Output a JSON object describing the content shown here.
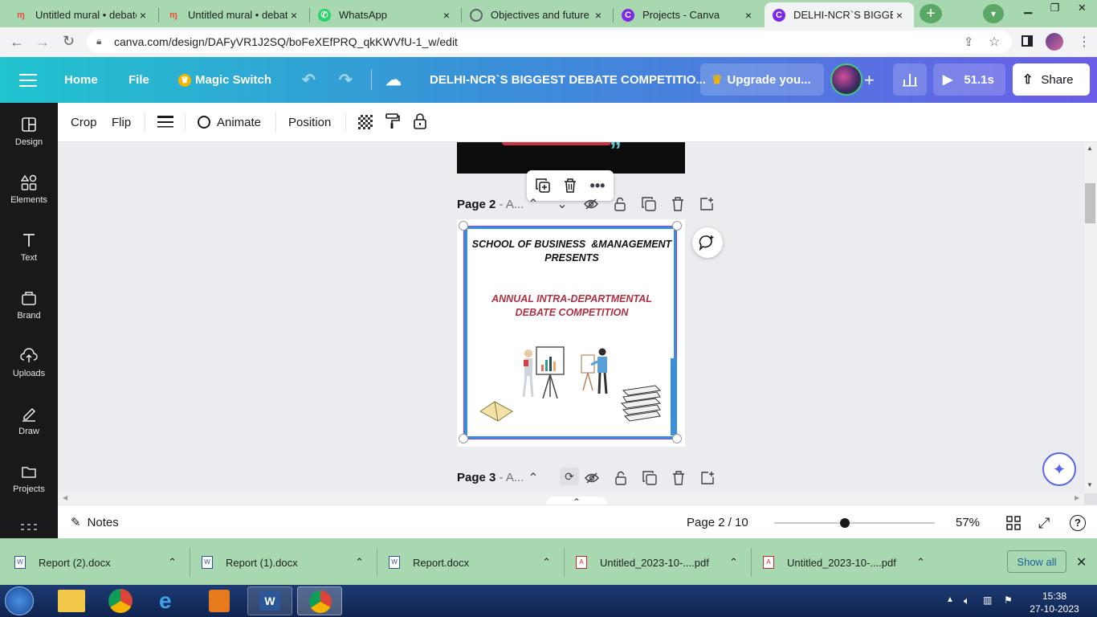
{
  "browser": {
    "tabs": [
      {
        "title": "Untitled mural • debate",
        "close": "×"
      },
      {
        "title": "Untitled mural • debate",
        "close": "×"
      },
      {
        "title": "WhatsApp",
        "close": "×"
      },
      {
        "title": "Objectives and future p",
        "close": "×"
      },
      {
        "title": "Projects - Canva",
        "close": "×"
      },
      {
        "title": "DELHI-NCR`S BIGGEST",
        "close": "×"
      }
    ],
    "url": "canva.com/design/DAFyVR1J2SQ/boFeXEfPRQ_qkKWVfU-1_w/edit"
  },
  "canva_header": {
    "home": "Home",
    "file": "File",
    "magic_switch": "Magic Switch",
    "design_title": "DELHI-NCR`S BIGGEST DEBATE COMPETITIO...",
    "upgrade": "Upgrade you...",
    "timer": "51.1s",
    "share": "Share"
  },
  "sidebar": {
    "items": [
      {
        "label": "Design"
      },
      {
        "label": "Elements"
      },
      {
        "label": "Text"
      },
      {
        "label": "Brand"
      },
      {
        "label": "Uploads"
      },
      {
        "label": "Draw"
      },
      {
        "label": "Projects"
      }
    ]
  },
  "edit_toolbar": {
    "crop": "Crop",
    "flip": "Flip",
    "animate": "Animate",
    "position": "Position"
  },
  "canvas": {
    "page2_label": "Page 2",
    "page2_suffix": " - A...",
    "page3_label": "Page 3",
    "page3_suffix": " - A...",
    "slide": {
      "line1": "SCHOOL OF BUSINESS  &MANAGEMENT",
      "line2": "PRESENTS",
      "line3": "ANNUAL INTRA-DEPARTMENTAL",
      "line4": "DEBATE COMPETITION"
    }
  },
  "footer": {
    "notes": "Notes",
    "page_indicator": "Page 2 / 10",
    "zoom": "57%",
    "zoom_fraction": 0.44
  },
  "downloads": {
    "items": [
      {
        "name": "Report (2).docx"
      },
      {
        "name": "Report (1).docx"
      },
      {
        "name": "Report.docx"
      },
      {
        "name": "Untitled_2023-10-....pdf"
      },
      {
        "name": "Untitled_2023-10-....pdf"
      }
    ],
    "show_all": "Show all"
  },
  "taskbar": {
    "time": "15:38",
    "date": "27-10-2023"
  },
  "colors": {
    "accent_teal": "#21c4cf",
    "accent_purple": "#6a5de8",
    "slide_red": "#b03040",
    "slide_border_blue": "#3a8fd8",
    "selection_purple": "#8b3dff"
  }
}
